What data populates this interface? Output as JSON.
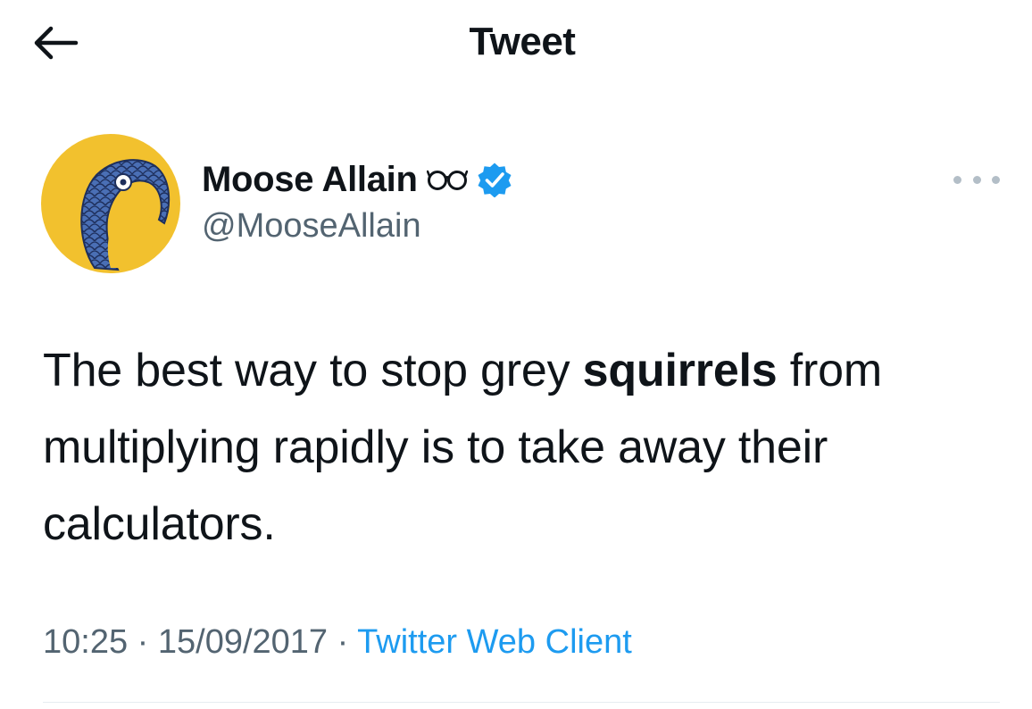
{
  "header": {
    "title": "Tweet"
  },
  "author": {
    "display_name": "Moose Allain",
    "handle": "@MooseAllain",
    "verified": true,
    "name_emoji": "glasses-icon"
  },
  "tweet": {
    "text_before": "The best way to stop grey ",
    "highlight": "squirrels",
    "text_after": " from multiplying rapidly is to take away their calculators."
  },
  "meta": {
    "time": "10:25",
    "separator": " · ",
    "date": "15/09/2017",
    "source": "Twitter Web Client"
  },
  "colors": {
    "accent": "#1d9bf0",
    "secondary_text": "#536471",
    "avatar_background": "#f2c12e",
    "avatar_bird": "#4a6fb5"
  }
}
